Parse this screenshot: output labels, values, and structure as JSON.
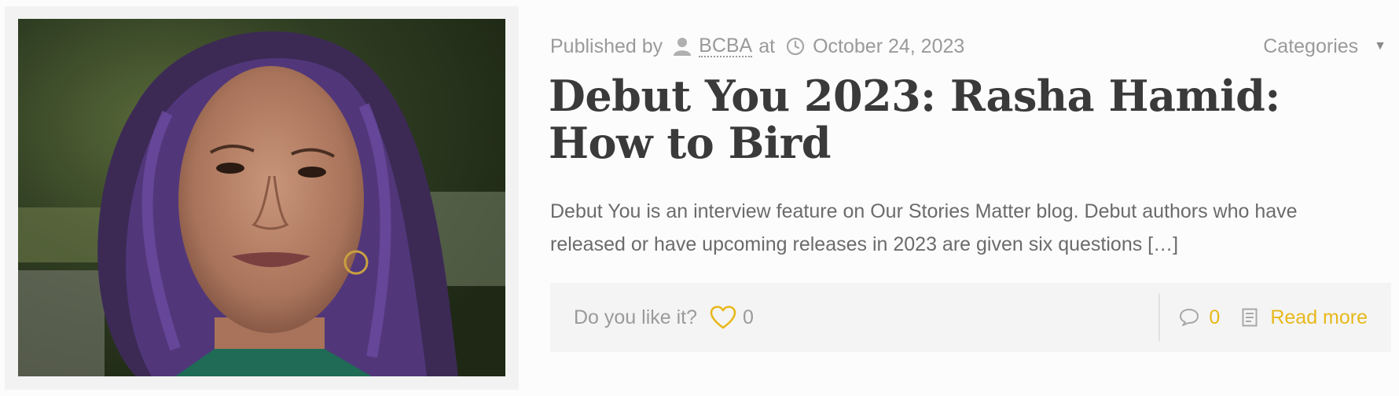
{
  "post": {
    "meta": {
      "published_by": "Published by",
      "author": "BCBA",
      "at": "at",
      "date": "October 24, 2023"
    },
    "categories_label": "Categories",
    "title": "Debut You 2023: Rasha Hamid: How to Bird",
    "excerpt": "Debut You is an interview feature on Our Stories Matter blog. Debut authors who have released or have upcoming releases in 2023 are given six questions […]",
    "footer": {
      "like_prompt": "Do you like it?",
      "like_count": "0",
      "comment_count": "0",
      "read_more": "Read more"
    }
  },
  "icons": {
    "author": "user-icon",
    "date": "clock-icon",
    "categories": "caret-down-icon",
    "like": "heart-icon",
    "comments": "comment-icon",
    "read_more": "document-icon"
  },
  "colors": {
    "accent": "#e8b81a",
    "muted_text": "#9a9a9a",
    "title_text": "#3a3a3a",
    "body_text": "#6b6b6b",
    "footer_bg": "#f4f4f4"
  }
}
